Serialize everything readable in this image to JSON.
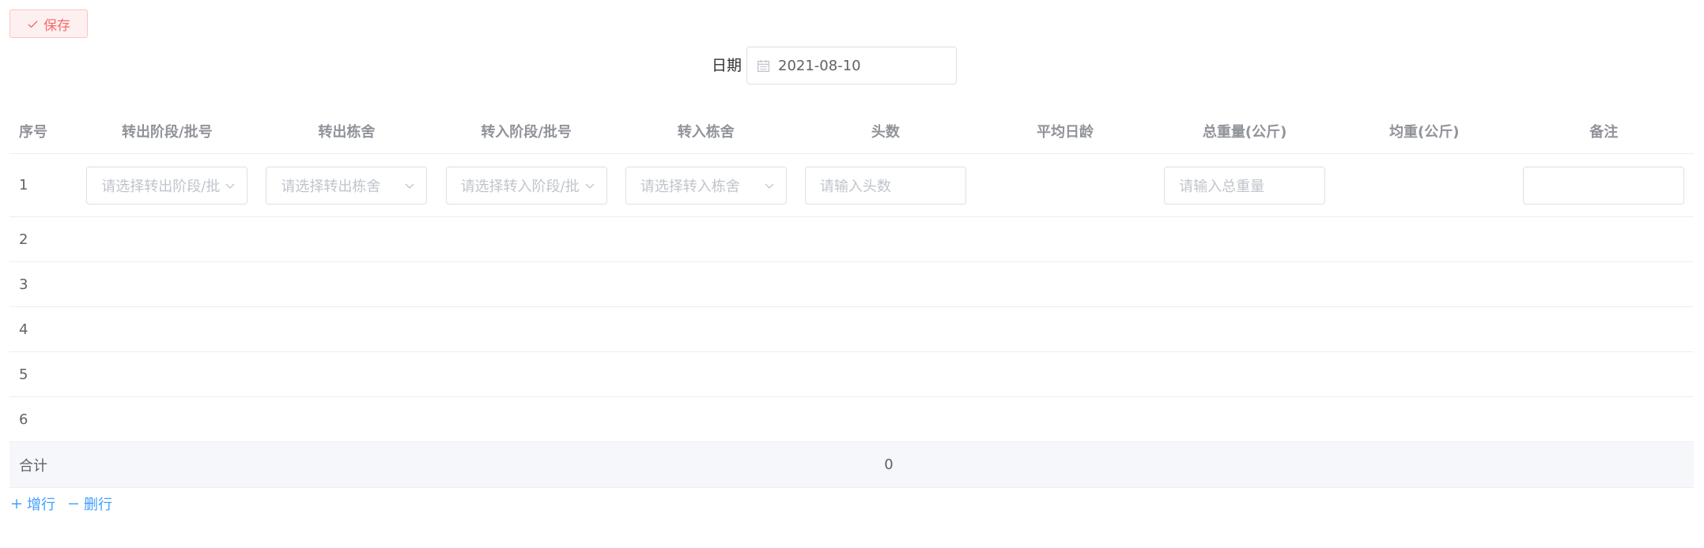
{
  "toolbar": {
    "save_label": "保存"
  },
  "date": {
    "label": "日期",
    "value": "2021-08-10"
  },
  "table": {
    "headers": [
      "序号",
      "转出阶段/批号",
      "转出栋舍",
      "转入阶段/批号",
      "转入栋舍",
      "头数",
      "平均日龄",
      "总重量(公斤)",
      "均重(公斤)",
      "备注"
    ],
    "placeholders": {
      "out_stage": "请选择转出阶段/批号",
      "out_house": "请选择转出栋舍",
      "in_stage": "请选择转入阶段/批号",
      "in_house": "请选择转入栋舍",
      "count": "请输入头数",
      "total_weight": "请输入总重量"
    },
    "rows": [
      "1",
      "2",
      "3",
      "4",
      "5",
      "6"
    ],
    "summary": {
      "label": "合计",
      "count": "0"
    }
  },
  "actions": {
    "add_row": "增行",
    "delete_row": "删行"
  },
  "colors": {
    "danger": "#f56c6c",
    "primary": "#409eff",
    "border": "#dcdfe6"
  }
}
